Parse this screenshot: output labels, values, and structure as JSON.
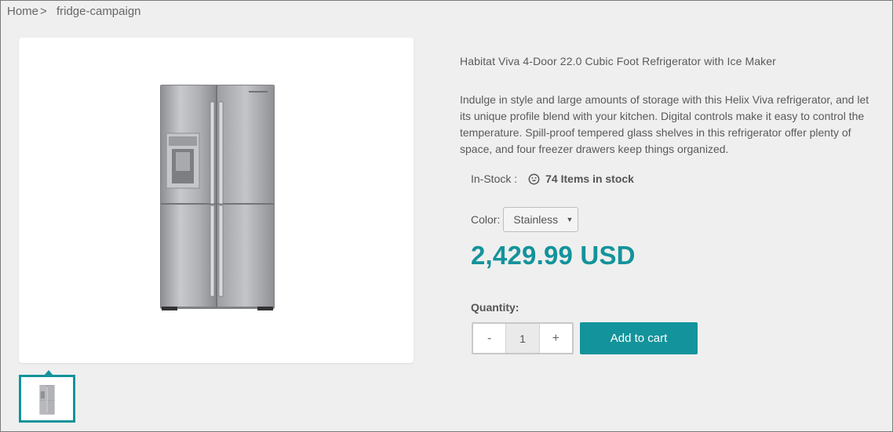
{
  "breadcrumb": {
    "home": "Home",
    "separator": ">",
    "current": "fridge-campaign"
  },
  "product": {
    "title": "Habitat Viva 4-Door 22.0 Cubic Foot Refrigerator with Ice Maker",
    "description": "Indulge in style and large amounts of storage with this Helix Viva refrigerator, and let its unique profile blend with your kitchen. Digital controls make it easy to control the temperature. Spill-proof tempered glass shelves in this refrigerator offer plenty of space, and four freezer drawers keep things organized.",
    "stock_label": "In-Stock :",
    "stock_icon": "smiley-icon",
    "stock_count": "74 Items in stock",
    "color_label": "Color:",
    "color_selected": "Stainless",
    "price": "2,429.99 USD",
    "quantity_label": "Quantity:",
    "quantity_value": "1",
    "decrement_label": "-",
    "increment_label": "+",
    "add_to_cart_label": "Add to cart"
  },
  "colors": {
    "accent": "#13939b",
    "background": "#efefef"
  }
}
